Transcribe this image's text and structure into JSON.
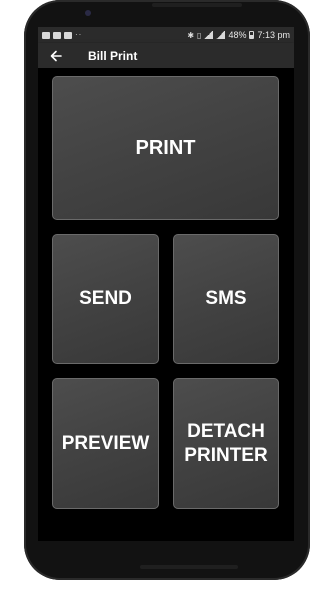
{
  "status_bar": {
    "battery_percent": "48%",
    "time": "7:13 pm",
    "notification_icons": [
      "image-icon",
      "chat-icon",
      "photo-icon"
    ],
    "more_indicator": "··"
  },
  "app_bar": {
    "title": "Bill Print",
    "back_icon": "arrow-left-icon"
  },
  "actions": {
    "print": "PRINT",
    "send": "SEND",
    "sms": "SMS",
    "preview": "PREVIEW",
    "detach_printer": "DETACH\nPRINTER"
  },
  "colors": {
    "background": "#000000",
    "app_bar": "#2b2b2b",
    "tile": "#454545",
    "tile_border": "#6a6a6a",
    "text": "#ffffff"
  }
}
